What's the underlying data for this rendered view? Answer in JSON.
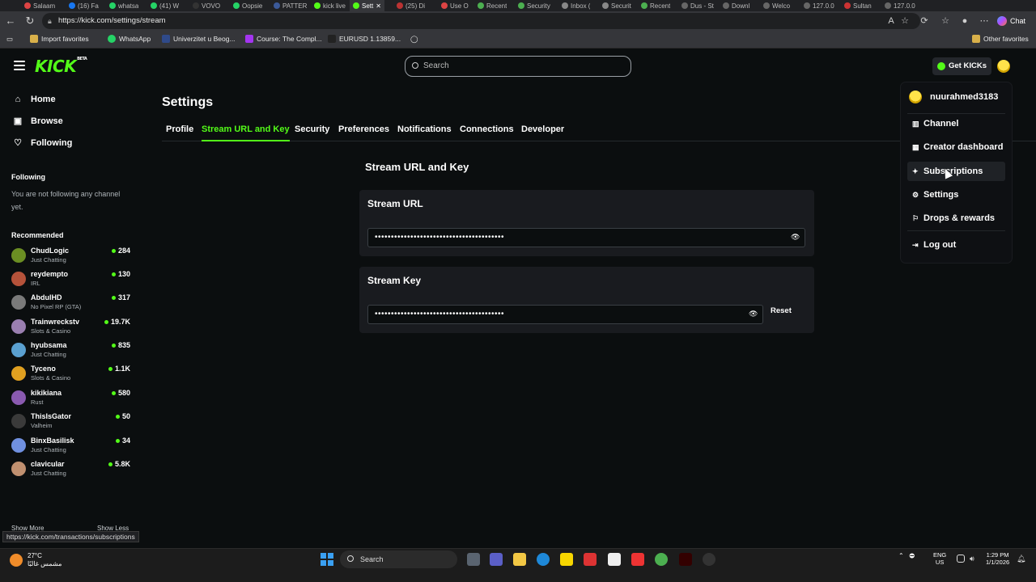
{
  "browser": {
    "tabs": [
      "Salaam",
      "(16) Fa",
      "whatsa",
      "(41) W",
      "VOVO",
      "Oopsie",
      "PATTER",
      "kick live",
      "Sett",
      "(25) Di",
      "Use O",
      "Recent",
      "Security",
      "Inbox (",
      "Securit",
      "Recent",
      "Dus - St",
      "Downl",
      "Welco",
      "127.0.0",
      "Sultan",
      "127.0.0"
    ],
    "url": "https://kick.com/settings/stream",
    "chat_label": "Chat",
    "favorites": [
      "Import favorites",
      "WhatsApp",
      "Univerzitet u Beog...",
      "Course: The Compl...",
      "EURUSD 1.13859..."
    ],
    "other_favorites": "Other favorites",
    "status_url": "https://kick.com/transactions/subscriptions"
  },
  "kick": {
    "logo": "KICK",
    "beta": "BETA",
    "search_placeholder": "Search",
    "get_kicks": "Get KICKs",
    "nav": [
      {
        "label": "Home",
        "icon": "home-icon"
      },
      {
        "label": "Browse",
        "icon": "browse-icon"
      },
      {
        "label": "Following",
        "icon": "heart-icon"
      }
    ],
    "following_heading": "Following",
    "not_following_text": "You are not following any channel yet.",
    "recommended_heading": "Recommended",
    "recommended": [
      {
        "name": "ChudLogic",
        "category": "Just Chatting",
        "viewers": "284",
        "color": "#6b8e23"
      },
      {
        "name": "reydempto",
        "category": "IRL",
        "viewers": "130",
        "color": "#b5523a"
      },
      {
        "name": "AbdulHD",
        "category": "No Pixel RP (GTA)",
        "viewers": "317",
        "color": "#7a7a7a"
      },
      {
        "name": "Trainwreckstv",
        "category": "Slots & Casino",
        "viewers": "19.7K",
        "color": "#9a7fb0"
      },
      {
        "name": "hyubsama",
        "category": "Just Chatting",
        "viewers": "835",
        "color": "#5aa0d0"
      },
      {
        "name": "Tyceno",
        "category": "Slots & Casino",
        "viewers": "1.1K",
        "color": "#e0a020"
      },
      {
        "name": "kikikiana",
        "category": "Rust",
        "viewers": "580",
        "color": "#8a5ab0"
      },
      {
        "name": "ThisIsGator",
        "category": "Valheim",
        "viewers": "50",
        "color": "#3a3a3a"
      },
      {
        "name": "BinxBasilisk",
        "category": "Just Chatting",
        "viewers": "34",
        "color": "#7090e0"
      },
      {
        "name": "clavicular",
        "category": "Just Chatting",
        "viewers": "5.8K",
        "color": "#c09070"
      }
    ],
    "show_more": "Show More",
    "show_less": "Show Less",
    "settings_title": "Settings",
    "settings_tabs": [
      "Profile",
      "Stream URL and Key",
      "Security",
      "Preferences",
      "Notifications",
      "Connections",
      "Developer"
    ],
    "active_tab": "Stream URL and Key",
    "section_title": "Stream URL and Key",
    "stream_url_label": "Stream URL",
    "stream_url_value": "••••••••••••••••••••••••••••••••••••••••",
    "stream_key_label": "Stream Key",
    "stream_key_value": "••••••••••••••••••••••••••••••••••••••••",
    "reset_label": "Reset",
    "menu": {
      "username": "nuurahmed3183",
      "items": [
        {
          "label": "Channel",
          "icon": "channel-icon"
        },
        {
          "label": "Creator dashboard",
          "icon": "dashboard-icon"
        },
        {
          "label": "Subscriptions",
          "icon": "subscriptions-icon"
        },
        {
          "label": "Settings",
          "icon": "gear-icon"
        },
        {
          "label": "Drops & rewards",
          "icon": "drops-icon"
        }
      ],
      "logout": "Log out"
    }
  },
  "taskbar": {
    "temperature": "27°C",
    "weather_text": "مشمس غالبًا",
    "search": "Search",
    "lang1": "ENG",
    "lang2": "US",
    "time": "1:29 PM",
    "date": "1/1/2026"
  },
  "colors": {
    "accent": "#53fc18",
    "background": "#0b0e0f",
    "card": "#191b1f"
  }
}
